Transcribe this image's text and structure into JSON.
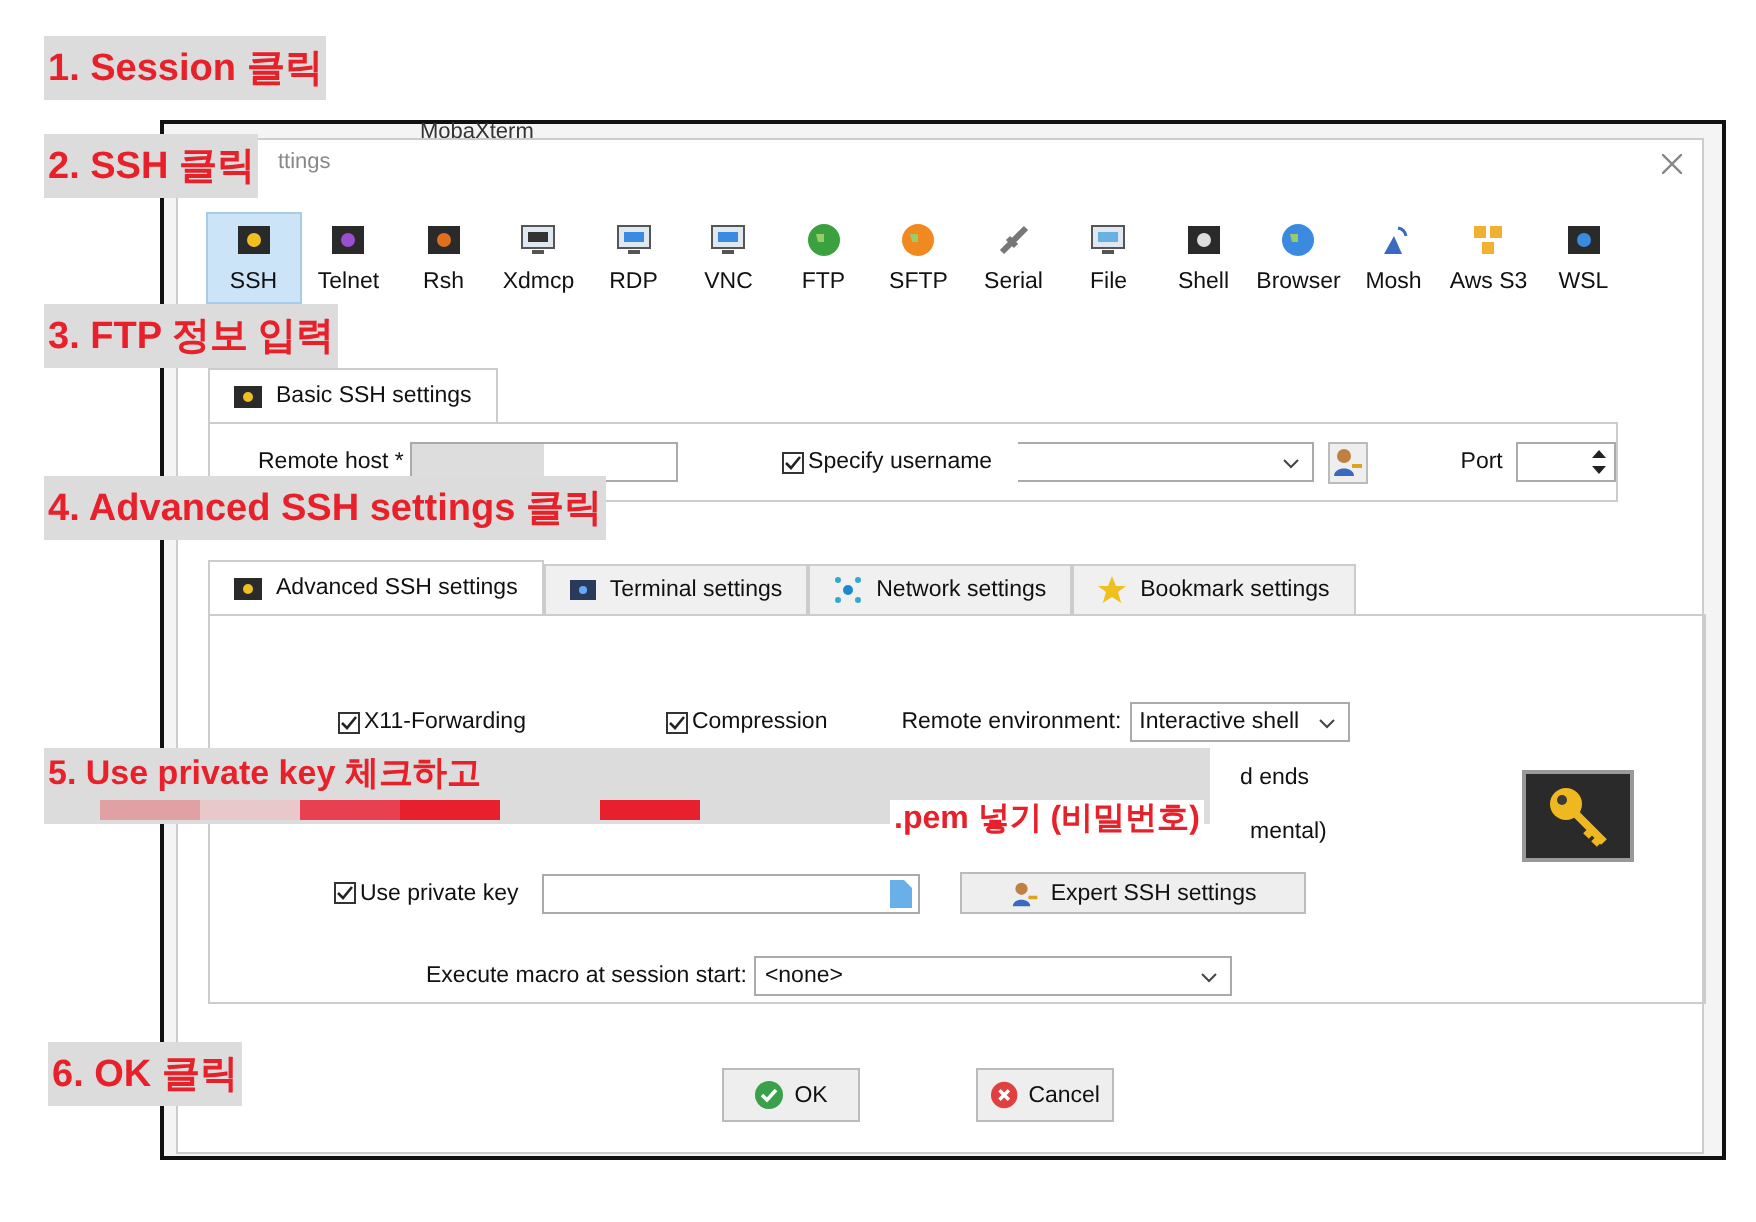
{
  "background_window": {
    "title": "MobaXterm"
  },
  "dialog": {
    "title": "ttings"
  },
  "session_types": [
    {
      "label": "SSH",
      "selected": true
    },
    {
      "label": "Telnet",
      "selected": false
    },
    {
      "label": "Rsh",
      "selected": false
    },
    {
      "label": "Xdmcp",
      "selected": false
    },
    {
      "label": "RDP",
      "selected": false
    },
    {
      "label": "VNC",
      "selected": false
    },
    {
      "label": "FTP",
      "selected": false
    },
    {
      "label": "SFTP",
      "selected": false
    },
    {
      "label": "Serial",
      "selected": false
    },
    {
      "label": "File",
      "selected": false
    },
    {
      "label": "Shell",
      "selected": false
    },
    {
      "label": "Browser",
      "selected": false
    },
    {
      "label": "Mosh",
      "selected": false
    },
    {
      "label": "Aws S3",
      "selected": false
    },
    {
      "label": "WSL",
      "selected": false
    }
  ],
  "basic_tab": {
    "label": "Basic SSH settings",
    "selected": true
  },
  "basic": {
    "remote_host_label": "Remote host *",
    "specify_username": {
      "label": "Specify username",
      "checked": true
    },
    "port_label": "Port"
  },
  "advanced_tabs": [
    {
      "label": "Advanced SSH settings",
      "selected": true
    },
    {
      "label": "Terminal settings",
      "selected": false
    },
    {
      "label": "Network settings",
      "selected": false
    },
    {
      "label": "Bookmark settings",
      "selected": false
    }
  ],
  "advanced": {
    "x11_forwarding": {
      "label": "X11-Forwarding",
      "checked": true
    },
    "compression": {
      "label": "Compression",
      "checked": true
    },
    "remote_environment_label": "Remote environment:",
    "remote_environment": "Interactive shell",
    "partial_texts": [
      "d ends",
      "mental)"
    ],
    "use_private_key": {
      "label": "Use private key",
      "checked": true
    },
    "expert_button": "Expert SSH settings",
    "macro_label": "Execute macro at session start:",
    "macro": "<none>"
  },
  "buttons": [
    {
      "label": "OK",
      "kind": "ok"
    },
    {
      "label": "Cancel",
      "kind": "cancel"
    }
  ],
  "annotations": [
    {
      "text": "1. Session 클릭"
    },
    {
      "text": "2. SSH 클릭"
    },
    {
      "text": "3. FTP 정보 입력"
    },
    {
      "text": "4. Advanced SSH settings 클릭"
    },
    {
      "text": "5. Use private key 체크하고",
      "note": ".pem 넣기 (비밀번호)"
    },
    {
      "text": "6. OK 클릭"
    }
  ]
}
